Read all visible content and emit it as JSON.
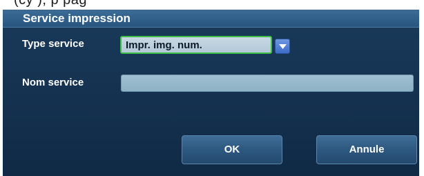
{
  "top_strip": {
    "text": "(cy            ), p                                  pag"
  },
  "dialog": {
    "title": "Service impression",
    "fields": {
      "type_label": "Type service",
      "type_value": "Impr. img. num.",
      "nom_label": "Nom service",
      "nom_value": ""
    },
    "buttons": {
      "ok": "OK",
      "cancel": "Annule"
    }
  },
  "icons": {
    "dropdown": "chevron-down-icon"
  },
  "colors": {
    "dialog_bg": "#14314f",
    "title_bar": "#28557e",
    "focus_border": "#3fbf48",
    "dropdown_button": "#3d6dc9",
    "input_bg": "#9ebfd0"
  }
}
